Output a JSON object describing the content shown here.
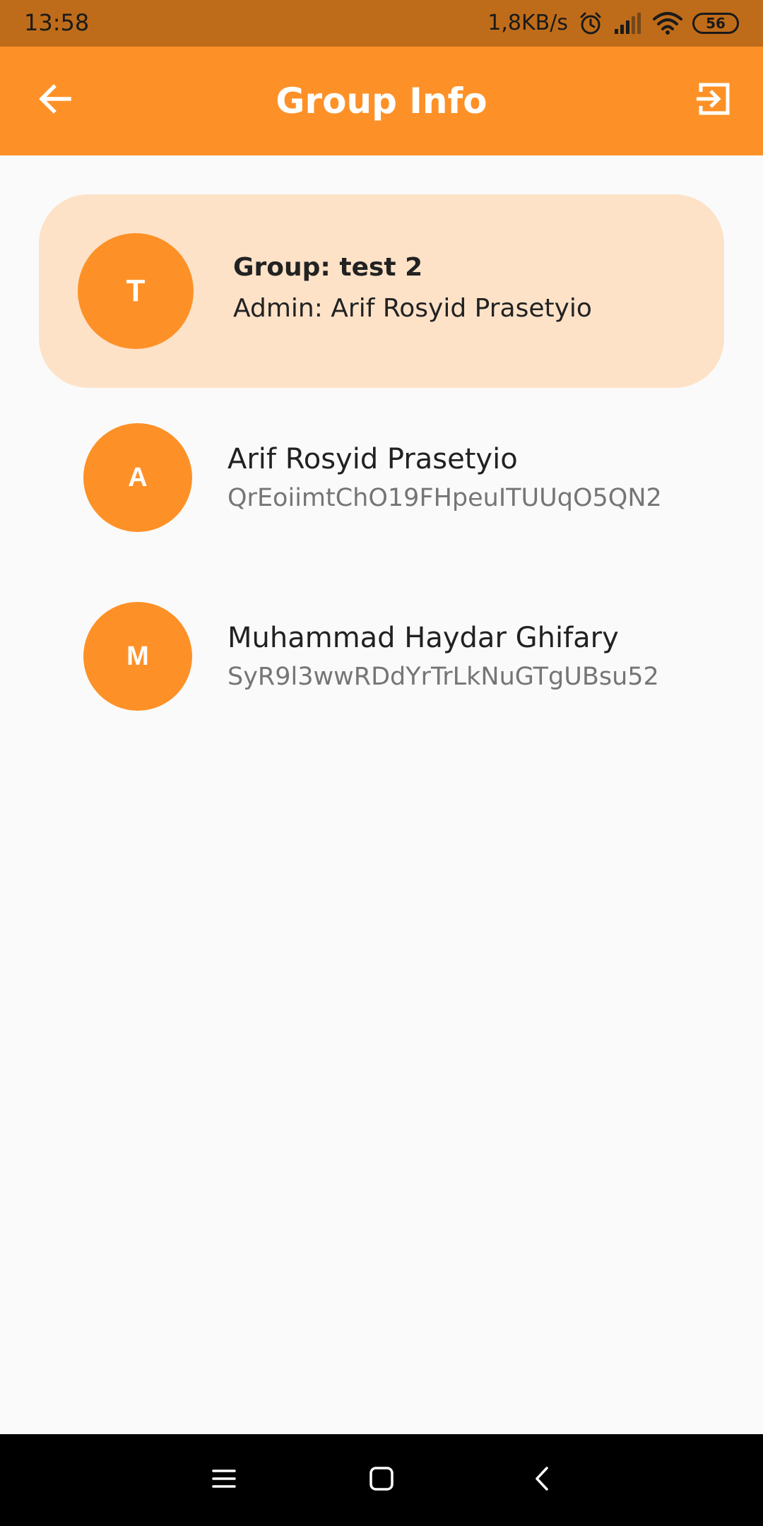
{
  "status_bar": {
    "time": "13:58",
    "network_speed": "1,8KB/s",
    "battery_level": "56",
    "icons": [
      "alarm-icon",
      "signal-icon",
      "wifi-icon",
      "battery-icon"
    ]
  },
  "app_bar": {
    "title": "Group Info",
    "left_icon": "arrow-back-icon",
    "right_icon": "exit-to-app-icon"
  },
  "group": {
    "avatar_letter": "T",
    "name_line": "Group: test 2",
    "admin_line": "Admin: Arif Rosyid Prasetyio"
  },
  "members": [
    {
      "avatar_letter": "A",
      "name": "Arif Rosyid Prasetyio",
      "uid": "QrEoiimtChO19FHpeuITUUqO5QN2"
    },
    {
      "avatar_letter": "M",
      "name": "Muhammad Haydar Ghifary",
      "uid": "SyR9l3wwRDdYrTrLkNuGTgUBsu52"
    }
  ],
  "nav_bar": {
    "icons": [
      "menu-icon",
      "home-square-icon",
      "back-chevron-icon"
    ]
  },
  "colors": {
    "accent": "#fd9127",
    "status_bar": "#bf6c1a",
    "card_background": "#fde2c8",
    "page_background": "#fafafa"
  }
}
